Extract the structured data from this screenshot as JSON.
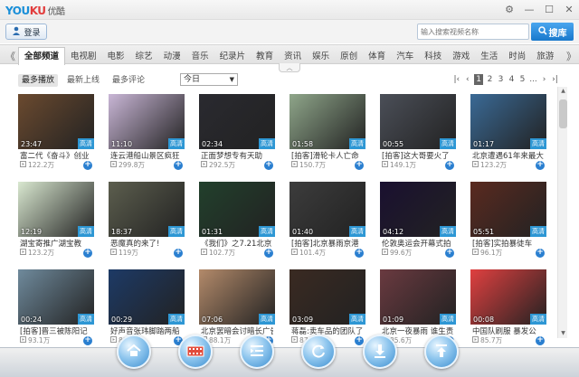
{
  "app": {
    "logo_part1": "YOU",
    "logo_part2": "KU",
    "logo_cn": "优酷"
  },
  "window_controls": [
    "settings-icon",
    "minimize-icon",
    "maximize-icon",
    "close-icon"
  ],
  "topbar": {
    "login_label": "登录",
    "search_placeholder": "输入搜索视频名称",
    "search_button": "搜库"
  },
  "categories": [
    "全部频道",
    "电视剧",
    "电影",
    "综艺",
    "动漫",
    "音乐",
    "纪录片",
    "教育",
    "资讯",
    "娱乐",
    "原创",
    "体育",
    "汽车",
    "科技",
    "游戏",
    "生活",
    "时尚",
    "旅游"
  ],
  "active_category": "全部频道",
  "sort": {
    "tabs": [
      "最多播放",
      "最新上线",
      "最多评论"
    ],
    "active": "最多播放",
    "range": "今日"
  },
  "pager": {
    "first": "|‹",
    "prev": "‹",
    "pages": [
      "1",
      "2",
      "3",
      "4",
      "5",
      "..."
    ],
    "current": "1",
    "next": "›",
    "last": "›|"
  },
  "hd_label": "高清",
  "videos": [
    {
      "title": "富二代《奋斗》创业",
      "views": "122.2万",
      "duration": "23:47",
      "bg": "#6b4a2f"
    },
    {
      "title": "连云港船山景区疯狂",
      "views": "299.8万",
      "duration": "11:10",
      "bg": "#c9b6d6"
    },
    {
      "title": "正面梦想专有天助",
      "views": "292.5万",
      "duration": "02:34",
      "bg": "#2a2a30"
    },
    {
      "title": "[拍客]滑轮卡人亡命",
      "views": "150.7万",
      "duration": "01:58",
      "bg": "#8fa68a"
    },
    {
      "title": "[拍客]这大哥要火了",
      "views": "149.1万",
      "duration": "00:55",
      "bg": "#4b4f58"
    },
    {
      "title": "北京遭遇61年来最大",
      "views": "123.2万",
      "duration": "01:17",
      "bg": "#3a6a96"
    },
    {
      "title": "湖宝寄推广湖宝教",
      "views": "123.2万",
      "duration": "12:19",
      "bg": "#d9e8d0"
    },
    {
      "title": "恶魔真的来了!",
      "views": "119万",
      "duration": "18:37",
      "bg": "#5c5e4e"
    },
    {
      "title": "《我们》之7.21北京",
      "views": "102.7万",
      "duration": "01:31",
      "bg": "#22402c"
    },
    {
      "title": "[拍客]北京暴雨京港",
      "views": "101.4万",
      "duration": "01:40",
      "bg": "#3c3c3c"
    },
    {
      "title": "伦敦奥运会开幕式拍",
      "views": "99.6万",
      "duration": "04:12",
      "bg": "#1a1030"
    },
    {
      "title": "[拍客]实拍暴徒车",
      "views": "96.1万",
      "duration": "05:51",
      "bg": "#5a2a20"
    },
    {
      "title": "[拍客]晋三被陈阳记",
      "views": "93.1万",
      "duration": "00:24",
      "bg": "#6f8a9c"
    },
    {
      "title": "好声音张玮脚踏两船",
      "views": "89.5万",
      "duration": "00:29",
      "bg": "#1d3a66"
    },
    {
      "title": "北京罢暗会讨暗长广告",
      "views": "88.1万",
      "duration": "07:06",
      "bg": "#b38a6a"
    },
    {
      "title": "蒋磊:卖车品的团队了",
      "views": "87.4万",
      "duration": "03:09",
      "bg": "#3a2a22"
    },
    {
      "title": "北京一夜暴雨 谁生责",
      "views": "85.6万",
      "duration": "01:09",
      "bg": "#6a3a40"
    },
    {
      "title": "中国队刷服 暴发公",
      "views": "85.7万",
      "duration": "00:08",
      "bg": "#e04040"
    }
  ],
  "dock": [
    "home-icon",
    "film-icon",
    "playlist-icon",
    "refresh-icon",
    "download-icon",
    "upload-icon"
  ]
}
